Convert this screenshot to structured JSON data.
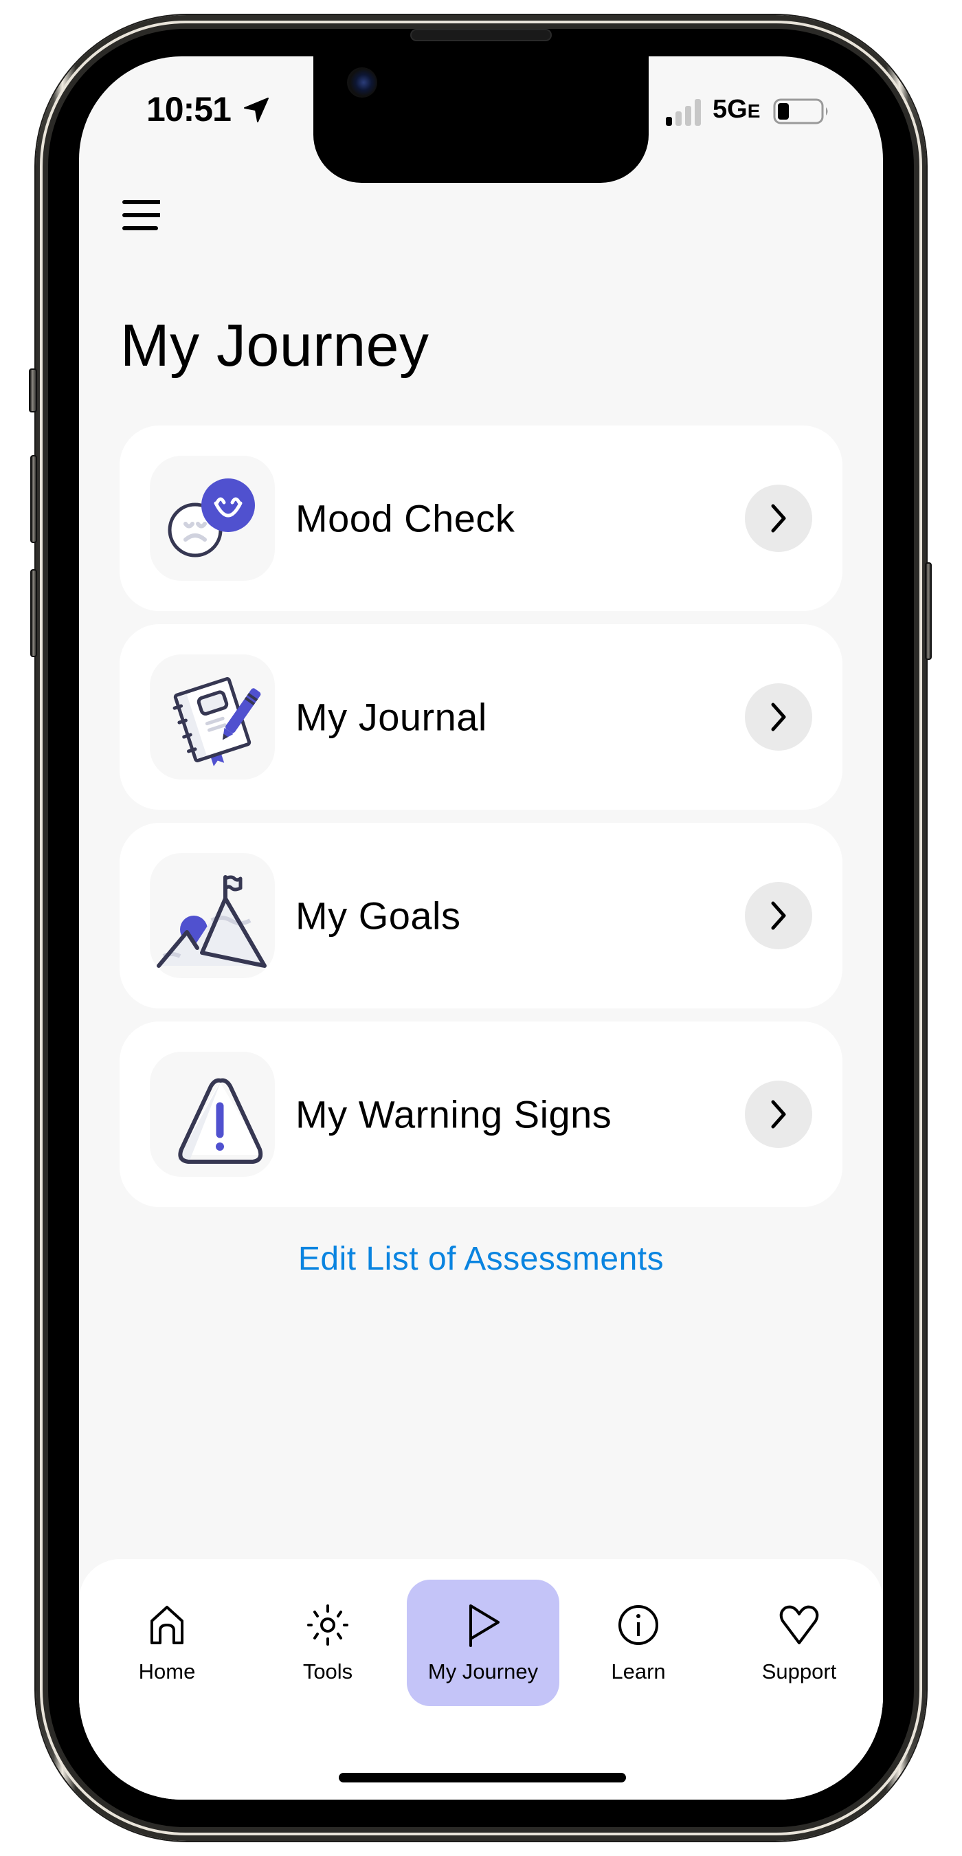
{
  "status_bar": {
    "time": "10:51",
    "network": "5G",
    "network_suffix": "E",
    "location_icon": "location-arrow-icon",
    "signal_icon": "cellular-signal-icon",
    "battery_icon": "battery-low-icon"
  },
  "header": {
    "menu_icon": "hamburger-menu-icon",
    "title": "My Journey"
  },
  "colors": {
    "accent": "#5051cf",
    "link": "#0a84e0",
    "active_tab_bg": "#c4c4f8",
    "icon_stroke": "#363752"
  },
  "cards": [
    {
      "label": "Mood Check",
      "icon": "mood-faces-icon",
      "action_icon": "chevron-right-icon"
    },
    {
      "label": "My Journal",
      "icon": "journal-notebook-icon",
      "action_icon": "chevron-right-icon"
    },
    {
      "label": "My Goals",
      "icon": "mountain-flag-icon",
      "action_icon": "chevron-right-icon"
    },
    {
      "label": "My Warning Signs",
      "icon": "warning-triangle-icon",
      "action_icon": "chevron-right-icon"
    }
  ],
  "edit_link": "Edit List of Assessments",
  "tabbar": {
    "active": "My Journey",
    "tabs": [
      {
        "label": "Home",
        "icon": "home-icon"
      },
      {
        "label": "Tools",
        "icon": "sun-tools-icon"
      },
      {
        "label": "My Journey",
        "icon": "flag-icon"
      },
      {
        "label": "Learn",
        "icon": "info-circle-icon"
      },
      {
        "label": "Support",
        "icon": "heart-icon"
      }
    ]
  }
}
